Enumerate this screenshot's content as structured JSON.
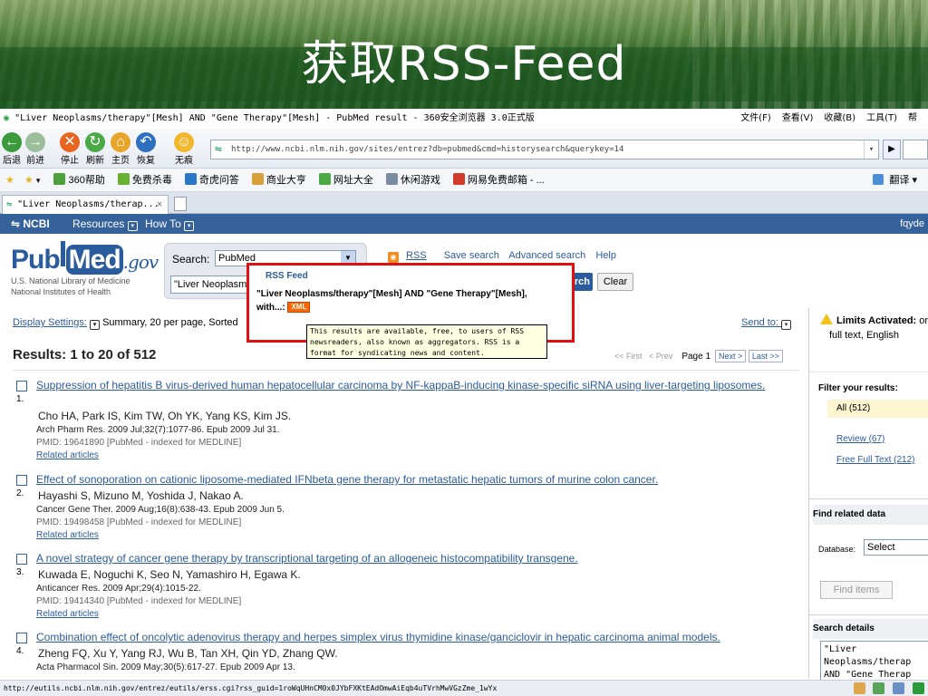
{
  "slide": {
    "title": "获取RSS-Feed"
  },
  "browser": {
    "window_title": "\"Liver Neoplasms/therapy\"[Mesh] AND \"Gene Therapy\"[Mesh] - PubMed result - 360安全浏览器 3.0正式版",
    "menus": [
      "文件(F)",
      "查看(V)",
      "收藏(B)",
      "工具(T)",
      "帮"
    ],
    "nav_buttons": [
      {
        "label": "后退",
        "color": "#3c9a3c",
        "glyph": "←"
      },
      {
        "label": "前进",
        "color": "#9bbf9b",
        "glyph": "→"
      },
      {
        "label": "停止",
        "color": "#e8651f",
        "glyph": "✕"
      },
      {
        "label": "刷新",
        "color": "#4aa845",
        "glyph": "↻"
      },
      {
        "label": "主页",
        "color": "#e9a52a",
        "glyph": "⌂"
      },
      {
        "label": "恢复",
        "color": "#2f6fc0",
        "glyph": "↶"
      },
      {
        "label": "无痕",
        "color": "#f1b72d",
        "glyph": "☺"
      }
    ],
    "address": "http://www.ncbi.nlm.nih.gov/sites/entrez?db=pubmed&cmd=historysearch&querykey=14",
    "favorites": [
      {
        "label": "360帮助",
        "color": "#4ca13a"
      },
      {
        "label": "免费杀毒",
        "color": "#66b032"
      },
      {
        "label": "奇虎问答",
        "color": "#2b78c9"
      },
      {
        "label": "商业大亨",
        "color": "#d8a03a"
      },
      {
        "label": "网址大全",
        "color": "#4aa845"
      },
      {
        "label": "休闲游戏",
        "color": "#7a8da0"
      },
      {
        "label": "网易免费邮箱 - ...",
        "color": "#d23b2b"
      }
    ],
    "translate_label": "翻译",
    "tab_title": "\"Liver Neoplasms/therap...",
    "status_url": "http://eutils.ncbi.nlm.nih.gov/entrez/eutils/erss.cgi?rss_guid=1roWqUHnCM0x0JYbFXKtEAdOmwAiEqb4uTVrhMwVGzZme_1wYx"
  },
  "ncbi": {
    "logo": "NCBI",
    "menu_resources": "Resources",
    "menu_howto": "How To",
    "user": "fqyde"
  },
  "pubmed": {
    "logo_pub": "Pub",
    "logo_med": "Med",
    "logo_gov": ".gov",
    "nlm_line1": "U.S. National Library of Medicine",
    "nlm_line2": "National Institutes of Health",
    "search_label": "Search:",
    "db_selected": "PubMed",
    "term": "\"Liver Neoplasms/therapy\"[Mesh] AND \"Gene Therapy\"[Mesh]",
    "search_btn": "rch",
    "clear_btn": "Clear",
    "links": [
      "RSS",
      "Save search",
      "Advanced search",
      "Help"
    ]
  },
  "results": {
    "display_settings": "Display Settings:",
    "display_value": "Summary, 20 per page, Sorted",
    "send_to": "Send to:",
    "title": "Results: 1 to 20 of 512",
    "pager_first": "<< First",
    "pager_prev": "< Prev",
    "pager_page": "Page 1",
    "pager_next": "Next >",
    "pager_last": "Last >>",
    "records": [
      {
        "num": "1.",
        "title": "Suppression of hepatitis B virus-derived human hepatocellular carcinoma by NF-kappaB-inducing kinase-specific siRNA using liver-targeting liposomes.",
        "authors": "Cho HA, Park IS, Kim TW, Oh YK, Yang KS, Kim JS.",
        "cite": "Arch Pharm Res. 2009 Jul;32(7):1077-86. Epub 2009 Jul 31.",
        "pmid": "PMID: 19641890 [PubMed - indexed for MEDLINE]",
        "related": "Related articles"
      },
      {
        "num": "2.",
        "title": "Effect of sonoporation on cationic liposome-mediated IFNbeta gene therapy for metastatic hepatic tumors of murine colon cancer.",
        "authors": "Hayashi S, Mizuno M, Yoshida J, Nakao A.",
        "cite": "Cancer Gene Ther. 2009 Aug;16(8):638-43. Epub 2009 Jun 5.",
        "pmid": "PMID: 19498458 [PubMed - indexed for MEDLINE]",
        "related": "Related articles"
      },
      {
        "num": "3.",
        "title": "A novel strategy of cancer gene therapy by transcriptional targeting of an allogeneic histocompatibility transgene.",
        "authors": "Kuwada E, Noguchi K, Seo N, Yamashiro H, Egawa K.",
        "cite": "Anticancer Res. 2009 Apr;29(4):1015-22.",
        "pmid": "PMID: 19414340 [PubMed - indexed for MEDLINE]",
        "related": "Related articles"
      },
      {
        "num": "4.",
        "title": "Combination effect of oncolytic adenovirus therapy and herpes simplex virus thymidine kinase/ganciclovir in hepatic carcinoma animal models.",
        "authors": "Zheng FQ, Xu Y, Yang RJ, Wu B, Tan XH, Qin YD, Zhang QW.",
        "cite": "Acta Pharmacol Sin. 2009 May;30(5):617-27. Epub 2009 Apr 13.",
        "pmid": "",
        "related": ""
      }
    ]
  },
  "sidebar": {
    "limits_label": "Limits Activated:",
    "limits_suffix": "or",
    "limits_line2": "full text, English",
    "filter_title": "Filter your results:",
    "filters": [
      "All (512)",
      "Review (67)",
      "Free Full Text (212)"
    ],
    "related_title": "Find related data",
    "database_label": "Database:",
    "database_value": "Select",
    "find_items": "Find items",
    "details_title": "Search details",
    "details_query": "\"Liver\nNeoplasms/therap\nAND \"Gene Therap"
  },
  "rss_popup": {
    "head": "RSS Feed",
    "body": "\"Liver Neoplasms/therapy\"[Mesh] AND \"Gene Therapy\"[Mesh], with...:",
    "xml": "XML",
    "tooltip": "This results are available, free, to users of RSS newsreaders, also known as aggregators. RSS is a format for syndicating news and content."
  }
}
